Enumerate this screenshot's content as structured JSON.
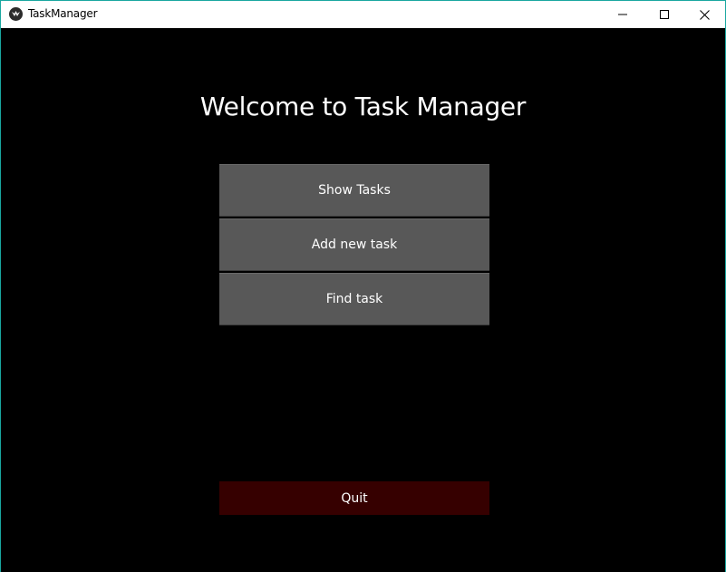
{
  "window": {
    "title": "TaskManager",
    "icon": "kivy-app-icon",
    "controls": {
      "minimize": "minimize-icon",
      "maximize": "maximize-icon",
      "close": "close-icon"
    }
  },
  "main": {
    "heading": "Welcome to Task Manager",
    "buttons": [
      {
        "label": "Show Tasks"
      },
      {
        "label": "Add new task"
      },
      {
        "label": "Find task"
      }
    ],
    "quit_label": "Quit"
  },
  "colors": {
    "background": "#000000",
    "button": "#585858",
    "quit_button": "#360000",
    "text": "#ffffff",
    "window_border": "#1aa7a0"
  }
}
